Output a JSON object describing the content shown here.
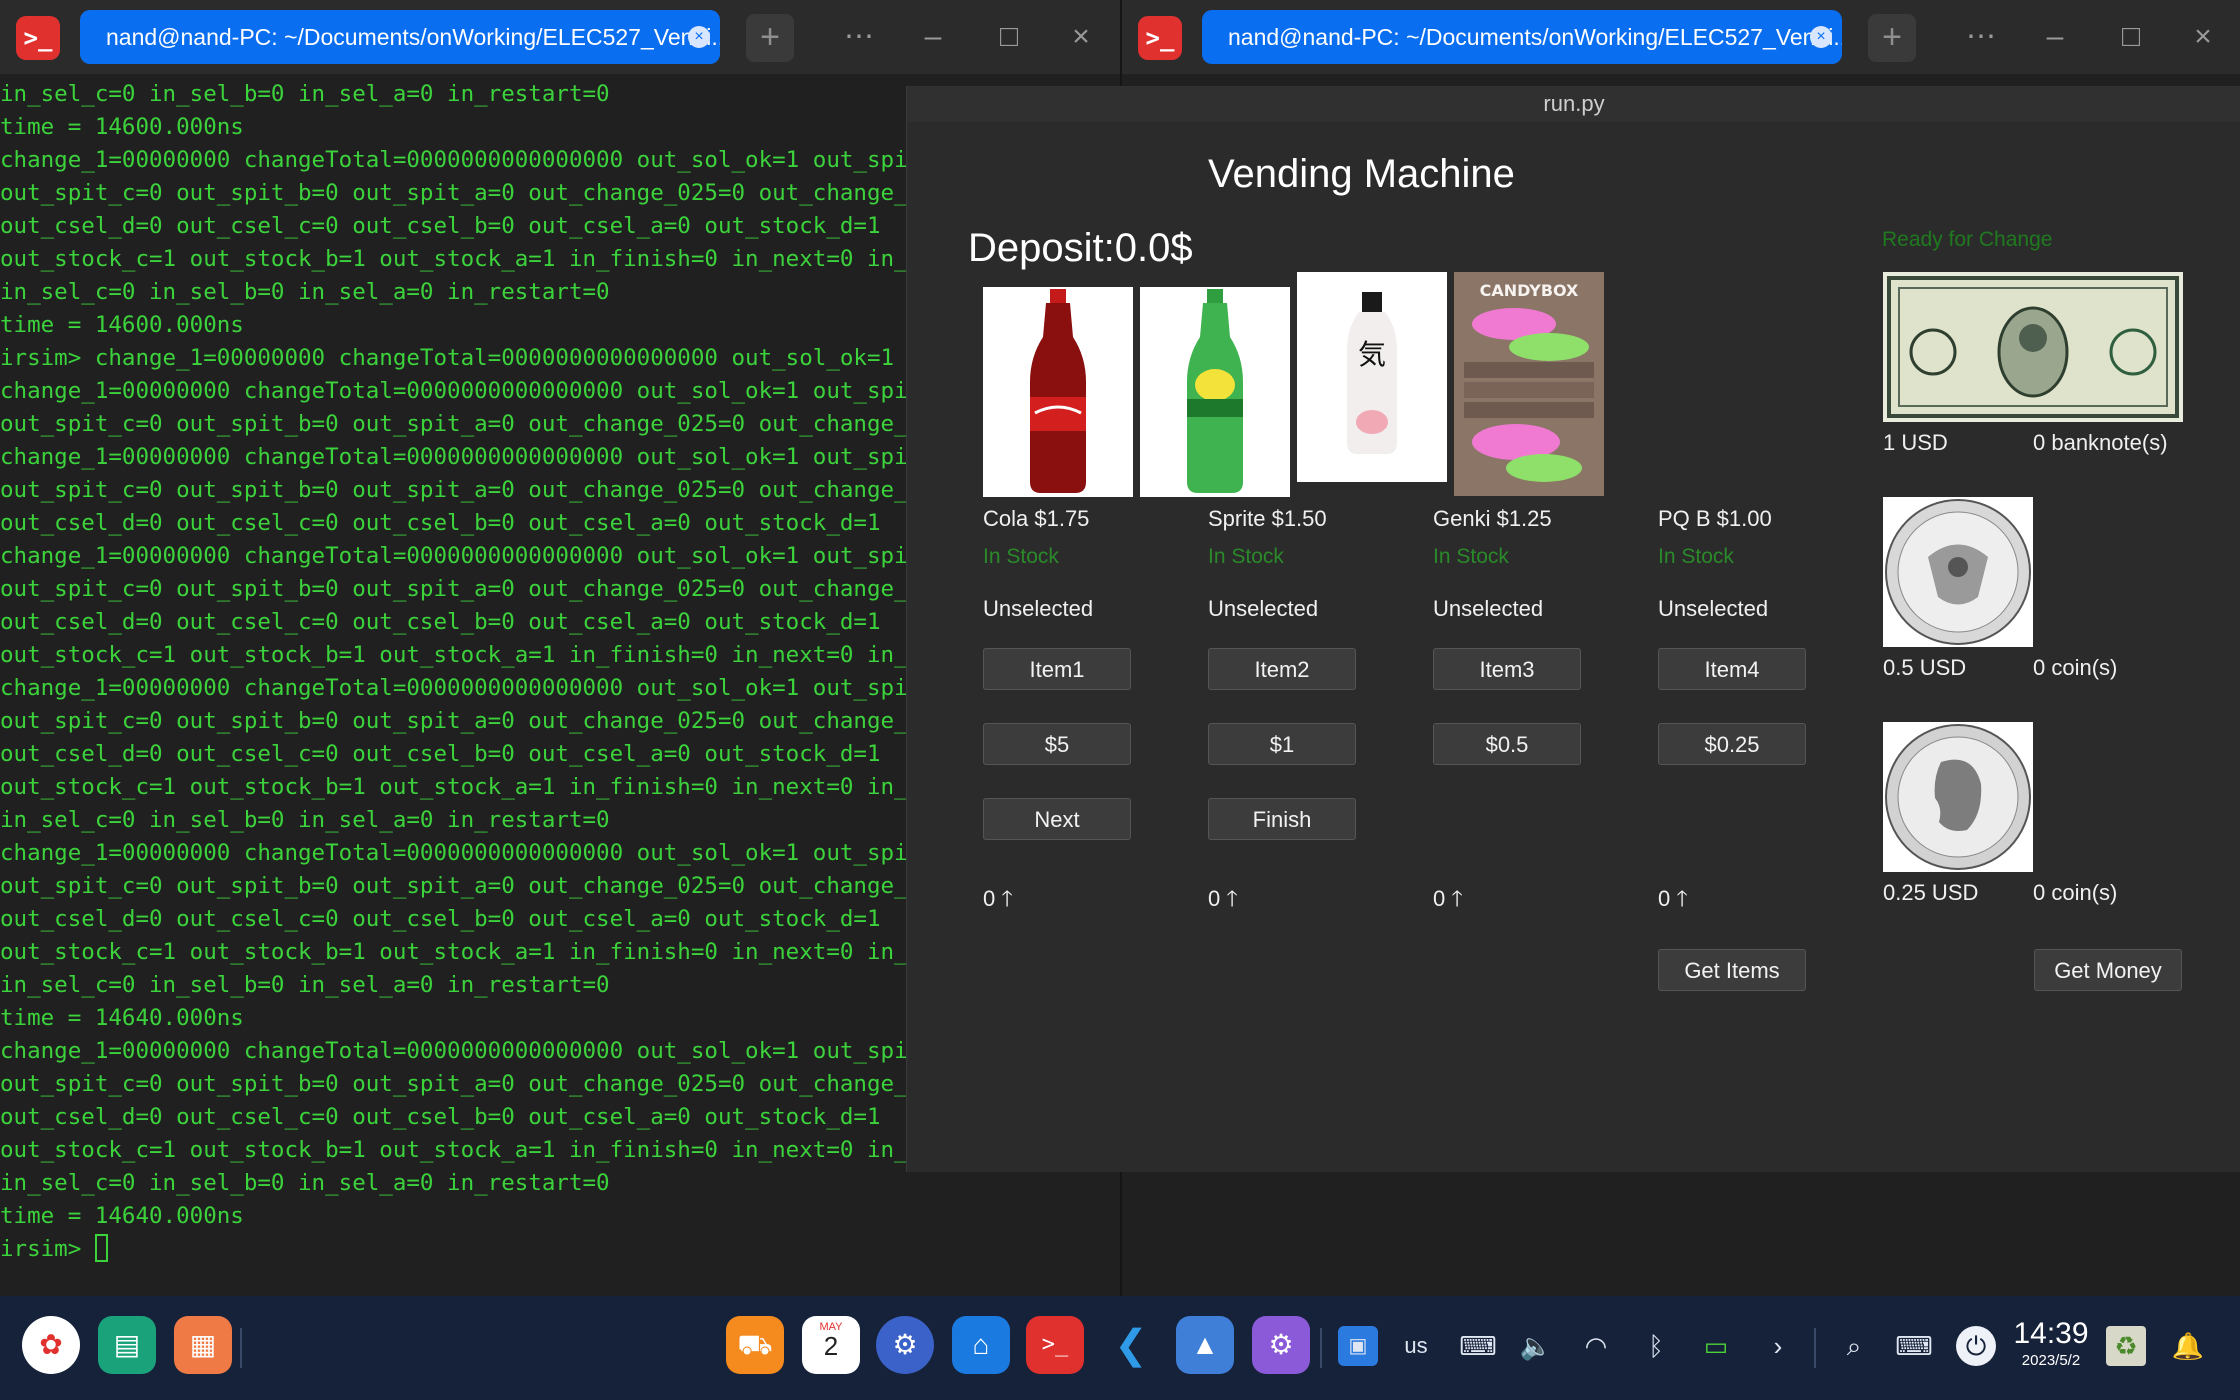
{
  "terminal_left": {
    "tab_title": "nand@nand-PC: ~/Documents/onWorking/ELEC527_Vendi...",
    "lines": [
      "in_sel_c=0 in_sel_b=0 in_sel_a=0 in_restart=0",
      "time = 14600.000ns",
      "change_1=00000000 changeTotal=0000000000000000 out_sol_ok=1 out_spi",
      "out_spit_c=0 out_spit_b=0 out_spit_a=0 out_change_025=0 out_change_",
      "out_csel_d=0 out_csel_c=0 out_csel_b=0 out_csel_a=0 out_stock_d=1",
      "out_stock_c=1 out_stock_b=1 out_stock_a=1 in_finish=0 in_next=0 in_",
      "in_sel_c=0 in_sel_b=0 in_sel_a=0 in_restart=0",
      "time = 14600.000ns",
      "irsim> change_1=00000000 changeTotal=0000000000000000 out_sol_ok=1 o",
      "change_1=00000000 changeTotal=0000000000000000 out_sol_ok=1 out_spi",
      "out_spit_c=0 out_spit_b=0 out_spit_a=0 out_change_025=0 out_change_",
      "change_1=00000000 changeTotal=0000000000000000 out_sol_ok=1 out_spi",
      "out_spit_c=0 out_spit_b=0 out_spit_a=0 out_change_025=0 out_change_",
      "out_csel_d=0 out_csel_c=0 out_csel_b=0 out_csel_a=0 out_stock_d=1",
      "change_1=00000000 changeTotal=0000000000000000 out_sol_ok=1 out_spi",
      "out_spit_c=0 out_spit_b=0 out_spit_a=0 out_change_025=0 out_change_",
      "out_csel_d=0 out_csel_c=0 out_csel_b=0 out_csel_a=0 out_stock_d=1",
      "out_stock_c=1 out_stock_b=1 out_stock_a=1 in_finish=0 in_next=0 in_",
      "change_1=00000000 changeTotal=0000000000000000 out_sol_ok=1 out_spi",
      "out_spit_c=0 out_spit_b=0 out_spit_a=0 out_change_025=0 out_change_",
      "out_csel_d=0 out_csel_c=0 out_csel_b=0 out_csel_a=0 out_stock_d=1",
      "out_stock_c=1 out_stock_b=1 out_stock_a=1 in_finish=0 in_next=0 in_",
      "in_sel_c=0 in_sel_b=0 in_sel_a=0 in_restart=0",
      "change_1=00000000 changeTotal=0000000000000000 out_sol_ok=1 out_spi",
      "out_spit_c=0 out_spit_b=0 out_spit_a=0 out_change_025=0 out_change_",
      "out_csel_d=0 out_csel_c=0 out_csel_b=0 out_csel_a=0 out_stock_d=1",
      "out_stock_c=1 out_stock_b=1 out_stock_a=1 in_finish=0 in_next=0 in_",
      "in_sel_c=0 in_sel_b=0 in_sel_a=0 in_restart=0",
      "time = 14640.000ns",
      "change_1=00000000 changeTotal=0000000000000000 out_sol_ok=1 out_spi",
      "out_spit_c=0 out_spit_b=0 out_spit_a=0 out_change_025=0 out_change_",
      "out_csel_d=0 out_csel_c=0 out_csel_b=0 out_csel_a=0 out_stock_d=1",
      "out_stock_c=1 out_stock_b=1 out_stock_a=1 in_finish=0 in_next=0 in_",
      "in_sel_c=0 in_sel_b=0 in_sel_a=0 in_restart=0",
      "time = 14640.000ns"
    ],
    "prompt": "irsim> "
  },
  "terminal_right": {
    "tab_title": "nand@nand-PC: ~/Documents/onWorking/ELEC527_Vendi..."
  },
  "app": {
    "window_title": "run.py",
    "heading": "Vending Machine",
    "deposit": "Deposit:0.0$",
    "change_status": "Ready for Change",
    "products": [
      {
        "label": "Cola $1.75",
        "stock": "In Stock",
        "selection": "Unselected",
        "item_button": "Item1",
        "count": "0"
      },
      {
        "label": "Sprite $1.50",
        "stock": "In Stock",
        "selection": "Unselected",
        "item_button": "Item2",
        "count": "0"
      },
      {
        "label": "Genki $1.25",
        "stock": "In Stock",
        "selection": "Unselected",
        "item_button": "Item3",
        "count": "0"
      },
      {
        "label": "PQ B $1.00",
        "stock": "In Stock",
        "selection": "Unselected",
        "item_button": "Item4",
        "count": "0"
      }
    ],
    "money_buttons": [
      "$5",
      "$1",
      "$0.5",
      "$0.25"
    ],
    "next_button": "Next",
    "finish_button": "Finish",
    "get_items_button": "Get Items",
    "get_money_button": "Get Money",
    "candy_box_text": "CANDYBOX",
    "currency": [
      {
        "value": "1 USD",
        "count": "0 banknote(s)"
      },
      {
        "value": "0.5 USD",
        "count": "0 coin(s)"
      },
      {
        "value": "0.25 USD",
        "count": "0 coin(s)"
      }
    ]
  },
  "taskbar": {
    "keyboard_layout": "us",
    "time": "14:39",
    "date": "2023/5/2",
    "calendar_day": "2",
    "calendar_month": "MAY"
  }
}
